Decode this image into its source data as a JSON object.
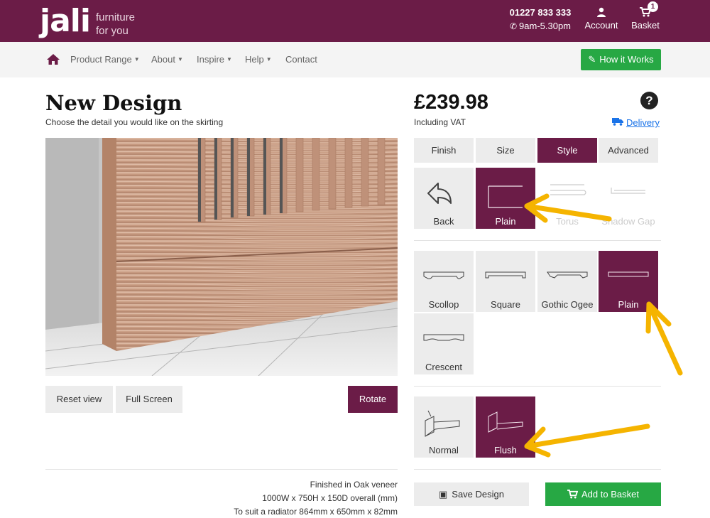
{
  "header": {
    "logo_text": "jali",
    "logo_tagline_1": "furniture",
    "logo_tagline_2": "for you",
    "phone": "01227 833 333",
    "hours": "9am-5.30pm",
    "account_label": "Account",
    "basket_label": "Basket",
    "basket_count": "1"
  },
  "nav": {
    "items": [
      {
        "label": "Product Range",
        "dropdown": true
      },
      {
        "label": "About",
        "dropdown": true
      },
      {
        "label": "Inspire",
        "dropdown": true
      },
      {
        "label": "Help",
        "dropdown": true
      },
      {
        "label": "Contact",
        "dropdown": false
      }
    ],
    "how_it_works": "How it Works"
  },
  "design": {
    "title": "New Design",
    "subtitle": "Choose the detail you would like on the skirting",
    "reset_view": "Reset view",
    "full_screen": "Full Screen",
    "rotate": "Rotate",
    "spec_finish": "Finished in Oak veneer",
    "spec_size": "1000W x 750H x 150D overall (mm)",
    "spec_radiator": "To suit a radiator 864mm x 650mm x 82mm"
  },
  "config": {
    "price": "£239.98",
    "vat_note": "Including VAT",
    "delivery_link": "Delivery",
    "tabs": [
      {
        "label": "Finish",
        "active": false
      },
      {
        "label": "Size",
        "active": false
      },
      {
        "label": "Style",
        "active": true
      },
      {
        "label": "Advanced",
        "active": false
      }
    ],
    "skirting_types": [
      {
        "label": "Back",
        "state": "normal"
      },
      {
        "label": "Plain",
        "state": "selected"
      },
      {
        "label": "Torus",
        "state": "faded"
      },
      {
        "label": "Shadow Gap",
        "state": "faded"
      }
    ],
    "profiles": [
      {
        "label": "Scollop",
        "state": "normal"
      },
      {
        "label": "Square",
        "state": "normal"
      },
      {
        "label": "Gothic Ogee",
        "state": "normal"
      },
      {
        "label": "Plain",
        "state": "selected"
      },
      {
        "label": "Crescent",
        "state": "normal"
      }
    ],
    "fitting": [
      {
        "label": "Normal",
        "state": "normal"
      },
      {
        "label": "Flush",
        "state": "selected"
      }
    ],
    "save_design": "Save Design",
    "add_to_basket": "Add to Basket"
  },
  "colors": {
    "brand": "#6b1c47",
    "green": "#27a844",
    "annotation_arrow": "#f5b400"
  }
}
